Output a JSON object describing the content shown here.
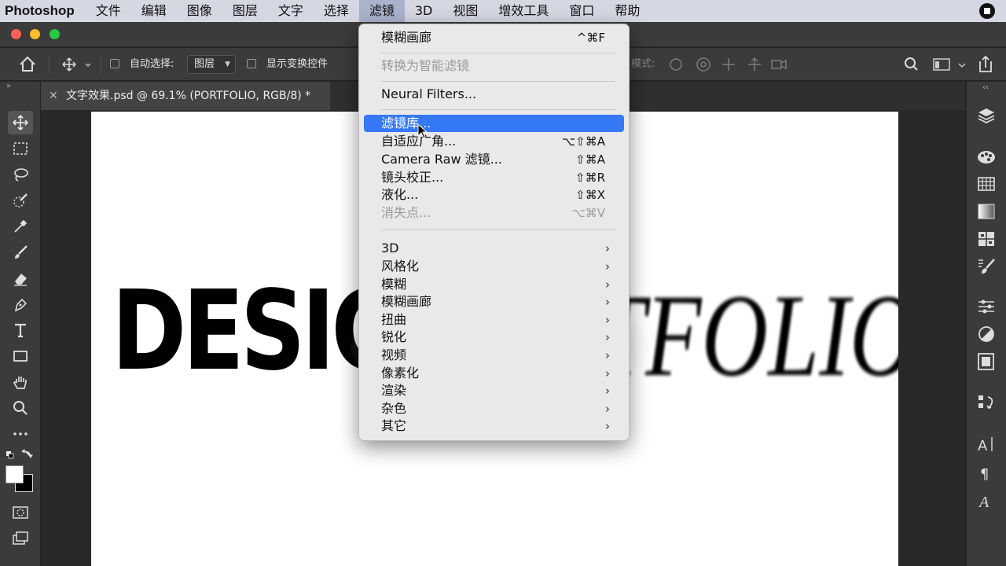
{
  "menubar": {
    "app": "Photoshop",
    "items": [
      "文件",
      "编辑",
      "图像",
      "图层",
      "文字",
      "选择",
      "滤镜",
      "3D",
      "视图",
      "增效工具",
      "窗口",
      "帮助"
    ],
    "active_index": 6
  },
  "options_bar": {
    "auto_select_label": "自动选择:",
    "auto_select_value": "图层",
    "show_transform_label": "显示变换控件",
    "mode_label": "模式:"
  },
  "document": {
    "tab_title": "文字效果.psd @ 69.1% (PORTFOLIO, RGB/8) *"
  },
  "canvas": {
    "text_left": "DESIG",
    "text_right": "TFOLIO"
  },
  "filter_menu": {
    "items": [
      {
        "label": "模糊画廊",
        "shortcut": "^⌘F",
        "disabled": false
      },
      {
        "label": "转换为智能滤镜",
        "shortcut": "",
        "disabled": true
      },
      {
        "label": "Neural Filters...",
        "shortcut": "",
        "disabled": false
      },
      {
        "label": "滤镜库...",
        "shortcut": "",
        "disabled": false,
        "highlighted": true
      },
      {
        "label": "自适应广角...",
        "shortcut": "⌥⇧⌘A",
        "disabled": false
      },
      {
        "label": "Camera Raw 滤镜...",
        "shortcut": "⇧⌘A",
        "disabled": false
      },
      {
        "label": "镜头校正...",
        "shortcut": "⇧⌘R",
        "disabled": false
      },
      {
        "label": "液化...",
        "shortcut": "⇧⌘X",
        "disabled": false
      },
      {
        "label": "消失点...",
        "shortcut": "⌥⌘V",
        "disabled": true
      }
    ],
    "submenus": [
      "3D",
      "风格化",
      "模糊",
      "模糊画廊",
      "扭曲",
      "锐化",
      "视频",
      "像素化",
      "渲染",
      "杂色",
      "其它"
    ]
  },
  "colors": {
    "highlight": "#3579f6",
    "close": "#fe5f57",
    "minimize": "#febc2e",
    "maximize": "#28c840"
  }
}
